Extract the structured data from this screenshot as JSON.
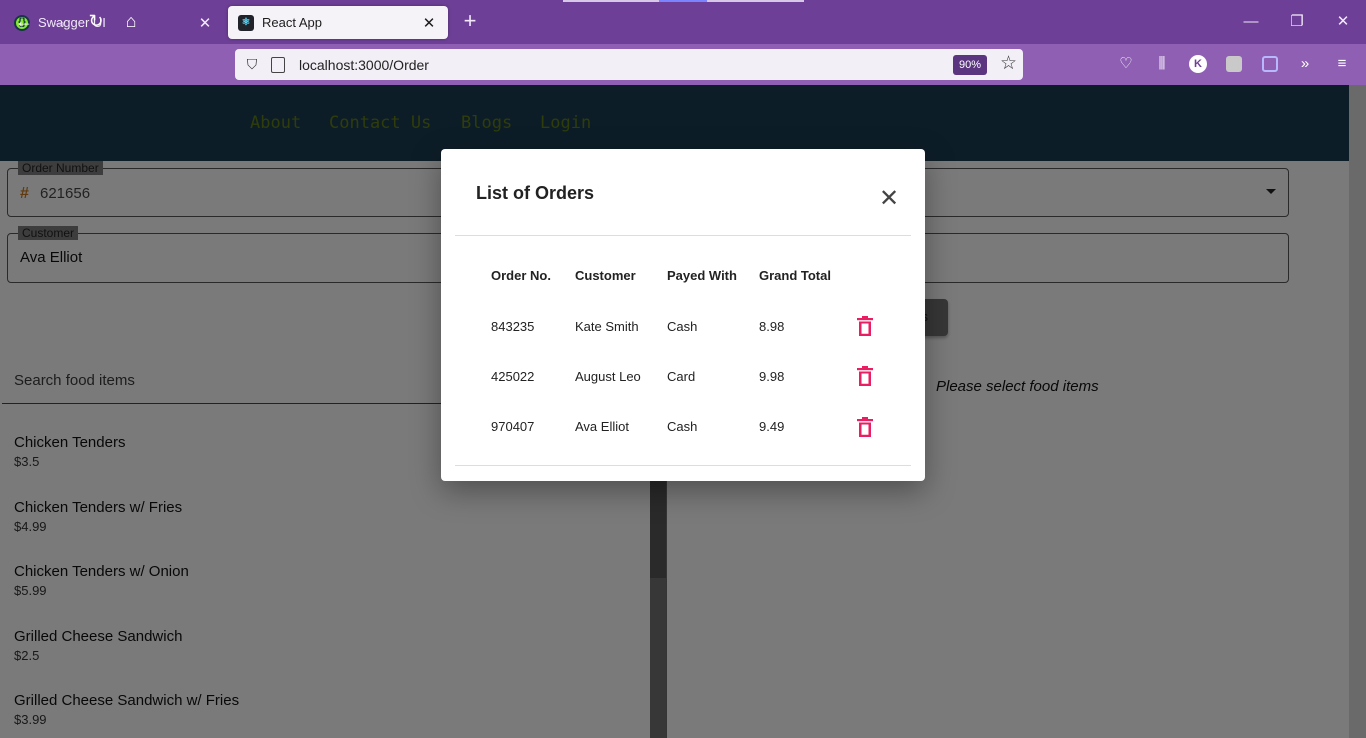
{
  "browser": {
    "tabs": [
      {
        "title": "Swagger UI",
        "icon": "swagger-icon",
        "active": false
      },
      {
        "title": "React App",
        "icon": "react-icon",
        "active": true
      }
    ],
    "url": "localhost:3000/Order",
    "zoom": "90%",
    "toolbar_icons": [
      "pocket-icon",
      "library-icon",
      "account-k-icon",
      "extension-icon",
      "extension-icon",
      "more-tools-icon",
      "menu-icon"
    ]
  },
  "header": {
    "nav": [
      "About",
      "Contact Us",
      "Blogs",
      "Login"
    ]
  },
  "form": {
    "order_number_label": "Order Number",
    "order_number_prefix": "#",
    "order_number": "621656",
    "customer_label": "Customer",
    "customer": "Ava Elliot"
  },
  "search": {
    "placeholder": "Search food items"
  },
  "food_items": [
    {
      "name": "Chicken Tenders",
      "price": "$3.5"
    },
    {
      "name": "Chicken Tenders w/ Fries",
      "price": "$4.99"
    },
    {
      "name": "Chicken Tenders w/ Onion",
      "price": "$5.99"
    },
    {
      "name": "Grilled Cheese Sandwich",
      "price": "$2.5"
    },
    {
      "name": "Grilled Cheese Sandwich w/ Fries",
      "price": "$3.99"
    }
  ],
  "order_panel": {
    "empty_message": "Please select food items",
    "submit_label_fragment": "s"
  },
  "dialog": {
    "title": "List of Orders",
    "columns": [
      "Order No.",
      "Customer",
      "Payed With",
      "Grand Total"
    ],
    "rows": [
      {
        "order_no": "843235",
        "customer": "Kate Smith",
        "payed_with": "Cash",
        "grand_total": "8.98"
      },
      {
        "order_no": "425022",
        "customer": "August Leo",
        "payed_with": "Card",
        "grand_total": "9.98"
      },
      {
        "order_no": "970407",
        "customer": "Ava Elliot",
        "payed_with": "Cash",
        "grand_total": "9.49"
      }
    ],
    "delete_color": "#e91e63"
  }
}
